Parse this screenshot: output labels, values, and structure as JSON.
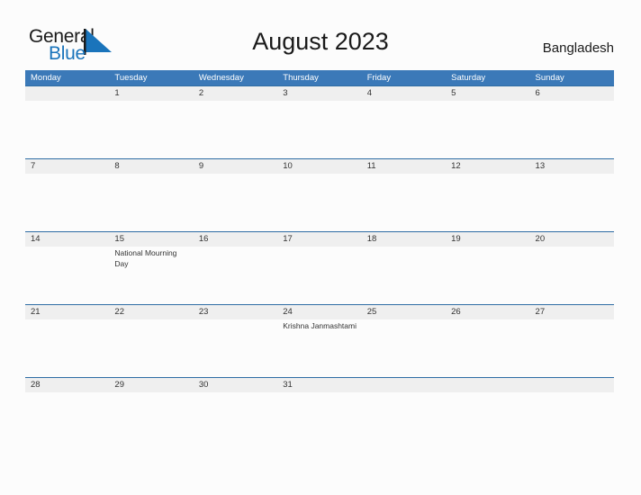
{
  "brand": {
    "name_part1": "General",
    "name_part2": "Blue",
    "logo_icon": "blue-flag-triangle-icon",
    "accent_color": "#1a74bb"
  },
  "header": {
    "title": "August 2023",
    "country": "Bangladesh"
  },
  "colors": {
    "header_row_blue": "#3b79b8",
    "row_separator_blue": "#2e6da4",
    "date_band_gray": "#efefef",
    "page_background": "#fcfcfc",
    "text_dark": "#333333"
  },
  "calendar": {
    "month": "August",
    "year": "2023",
    "weekday_headers": [
      "Monday",
      "Tuesday",
      "Wednesday",
      "Thursday",
      "Friday",
      "Saturday",
      "Sunday"
    ],
    "weeks": [
      {
        "days": [
          {
            "num": "",
            "event": ""
          },
          {
            "num": "1",
            "event": ""
          },
          {
            "num": "2",
            "event": ""
          },
          {
            "num": "3",
            "event": ""
          },
          {
            "num": "4",
            "event": ""
          },
          {
            "num": "5",
            "event": ""
          },
          {
            "num": "6",
            "event": ""
          }
        ]
      },
      {
        "days": [
          {
            "num": "7",
            "event": ""
          },
          {
            "num": "8",
            "event": ""
          },
          {
            "num": "9",
            "event": ""
          },
          {
            "num": "10",
            "event": ""
          },
          {
            "num": "11",
            "event": ""
          },
          {
            "num": "12",
            "event": ""
          },
          {
            "num": "13",
            "event": ""
          }
        ]
      },
      {
        "days": [
          {
            "num": "14",
            "event": ""
          },
          {
            "num": "15",
            "event": "National Mourning Day"
          },
          {
            "num": "16",
            "event": ""
          },
          {
            "num": "17",
            "event": ""
          },
          {
            "num": "18",
            "event": ""
          },
          {
            "num": "19",
            "event": ""
          },
          {
            "num": "20",
            "event": ""
          }
        ]
      },
      {
        "days": [
          {
            "num": "21",
            "event": ""
          },
          {
            "num": "22",
            "event": ""
          },
          {
            "num": "23",
            "event": ""
          },
          {
            "num": "24",
            "event": "Krishna Janmashtami"
          },
          {
            "num": "25",
            "event": ""
          },
          {
            "num": "26",
            "event": ""
          },
          {
            "num": "27",
            "event": ""
          }
        ]
      },
      {
        "days": [
          {
            "num": "28",
            "event": ""
          },
          {
            "num": "29",
            "event": ""
          },
          {
            "num": "30",
            "event": ""
          },
          {
            "num": "31",
            "event": ""
          },
          {
            "num": "",
            "event": ""
          },
          {
            "num": "",
            "event": ""
          },
          {
            "num": "",
            "event": ""
          }
        ]
      }
    ]
  }
}
